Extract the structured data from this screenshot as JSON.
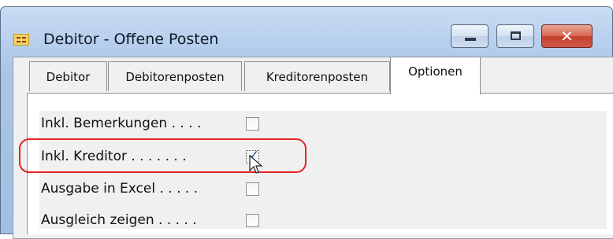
{
  "window": {
    "title": "Debitor - Offene Posten",
    "controls": {
      "minimize": "minimize",
      "maximize": "maximize",
      "close": "✕"
    }
  },
  "tabs": [
    {
      "label": "Debitor",
      "active": false
    },
    {
      "label": "Debitorenposten",
      "active": false
    },
    {
      "label": "Kreditorenposten",
      "active": false
    },
    {
      "label": "Optionen",
      "active": true
    }
  ],
  "options": [
    {
      "label": "Inkl. Bemerkungen . . . .",
      "checked": false
    },
    {
      "label": "Inkl. Kreditor . . . . . . .",
      "checked": true
    },
    {
      "label": "Ausgabe in Excel . . . . .",
      "checked": false
    },
    {
      "label": "Ausgleich zeigen . . . . .",
      "checked": false
    }
  ],
  "colors": {
    "highlight": "#e62424",
    "close_button": "#c1402a",
    "checkmark": "#2a4d8f"
  }
}
